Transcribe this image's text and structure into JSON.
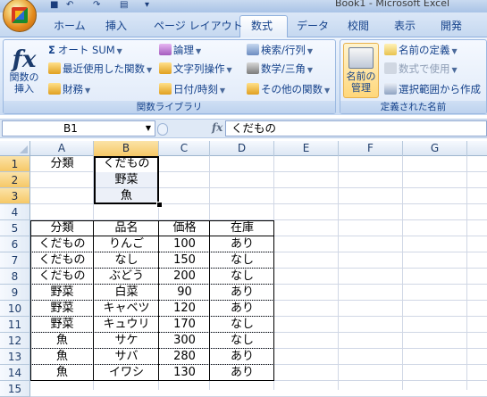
{
  "window": {
    "title": "Book1 - Microsoft Excel"
  },
  "tabs": [
    "ホーム",
    "挿入",
    "ページ レイアウト",
    "数式",
    "データ",
    "校閲",
    "表示",
    "開発"
  ],
  "active_tab": "数式",
  "ribbon": {
    "function_library": {
      "label": "関数ライブラリ",
      "insert_function": [
        "関数の",
        "挿入"
      ],
      "autosum": "オート SUM",
      "recent": "最近使用した関数",
      "financial": "財務",
      "logical": "論理",
      "text": "文字列操作",
      "datetime": "日付/時刻",
      "lookup": "検索/行列",
      "math": "数学/三角",
      "other": "その他の関数"
    },
    "defined_names": {
      "label": "定義された名前",
      "name_manager": [
        "名前の",
        "管理"
      ],
      "define_name": "名前の定義",
      "use_in_formula": "数式で使用",
      "create_from_selection": "選択範囲から作成"
    }
  },
  "formula_bar": {
    "name_box": "B1",
    "fx": "fx",
    "value": "くだもの"
  },
  "columns": [
    "A",
    "B",
    "C",
    "D",
    "E",
    "F",
    "G"
  ],
  "selected_column": "B",
  "rows": [
    "1",
    "2",
    "3",
    "4",
    "5",
    "6",
    "7",
    "8",
    "9",
    "10",
    "11",
    "12",
    "13",
    "14",
    "15"
  ],
  "selected_rows": [
    "1",
    "2",
    "3"
  ],
  "cells": {
    "A1": "分類",
    "B1": "くだもの",
    "B2": "野菜",
    "B3": "魚",
    "table_header": [
      "分類",
      "品名",
      "価格",
      "在庫"
    ],
    "table_rows": [
      [
        "くだもの",
        "りんご",
        "100",
        "あり"
      ],
      [
        "くだもの",
        "なし",
        "150",
        "なし"
      ],
      [
        "くだもの",
        "ぶどう",
        "200",
        "なし"
      ],
      [
        "野菜",
        "白菜",
        "90",
        "あり"
      ],
      [
        "野菜",
        "キャベツ",
        "120",
        "あり"
      ],
      [
        "野菜",
        "キュウリ",
        "170",
        "なし"
      ],
      [
        "魚",
        "サケ",
        "300",
        "なし"
      ],
      [
        "魚",
        "サバ",
        "280",
        "あり"
      ],
      [
        "魚",
        "イワシ",
        "130",
        "あり"
      ]
    ]
  }
}
